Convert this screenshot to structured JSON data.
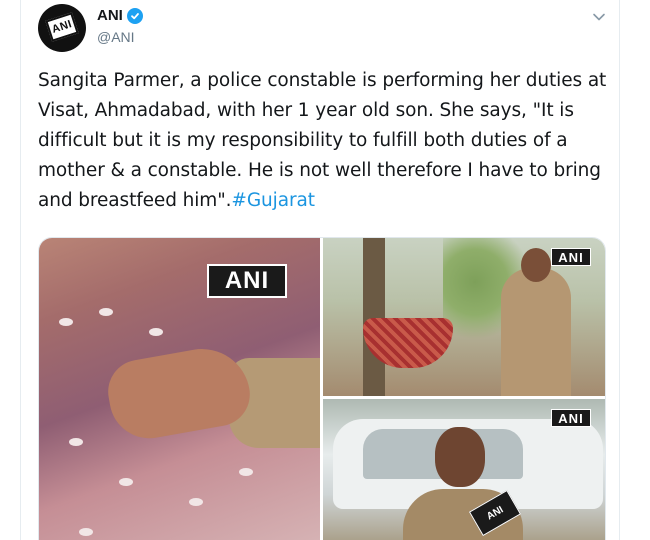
{
  "account": {
    "display_name": "ANI",
    "handle": "@ANI",
    "verified": true,
    "avatar_text": "ANI"
  },
  "tweet": {
    "text": "Sangita Parmer, a police constable is performing her duties at Visat, Ahmadabad, with her 1 year old son. She says, \"It is difficult but it is my responsibility to fulfill both duties of a mother & a constable. He is not well therefore I have to bring and breastfeed him\".",
    "hashtag": "#Gujarat"
  },
  "media": {
    "watermark": "ANI",
    "mic_label": "ANI"
  },
  "colors": {
    "link": "#1b95e0",
    "verified": "#1da1f2",
    "secondary_text": "#657786"
  },
  "icons": [
    "verified-badge-icon",
    "chevron-down-icon"
  ]
}
